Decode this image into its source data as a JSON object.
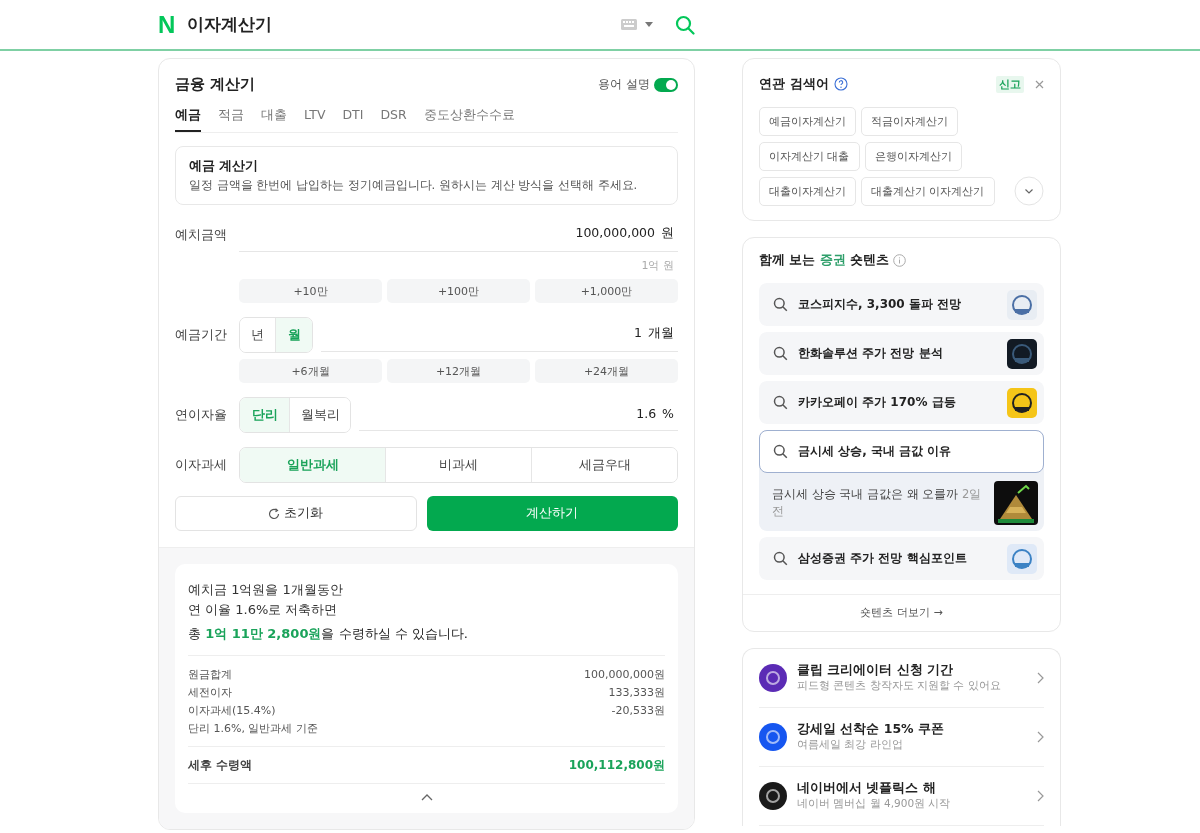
{
  "header": {
    "logo": "N",
    "title": "이자계산기"
  },
  "calculator": {
    "title": "금융 계산기",
    "term_toggle": {
      "label": "용어 설명",
      "on": true
    },
    "tabs": [
      {
        "label": "예금",
        "selected": true
      },
      {
        "label": "적금",
        "selected": false
      },
      {
        "label": "대출",
        "selected": false
      },
      {
        "label": "LTV",
        "selected": false
      },
      {
        "label": "DTI",
        "selected": false
      },
      {
        "label": "DSR",
        "selected": false
      },
      {
        "label": "중도상환수수료",
        "selected": false
      }
    ],
    "info": {
      "title": "예금 계산기",
      "description": "일정 금액을 한번에 납입하는 정기예금입니다. 원하시는 계산 방식을 선택해 주세요."
    },
    "amount": {
      "label": "예치금액",
      "value": "100,000,000",
      "unit": "원",
      "hint": "1억 원",
      "quick": [
        "+10만",
        "+100만",
        "+1,000만"
      ]
    },
    "period": {
      "label": "예금기간",
      "units": [
        {
          "label": "년",
          "selected": false
        },
        {
          "label": "월",
          "selected": true
        }
      ],
      "value": "1",
      "unit": "개월",
      "quick": [
        "+6개월",
        "+12개월",
        "+24개월"
      ]
    },
    "rate": {
      "label": "연이자율",
      "types": [
        {
          "label": "단리",
          "selected": true
        },
        {
          "label": "월복리",
          "selected": false
        }
      ],
      "value": "1.6",
      "unit": "%"
    },
    "tax": {
      "label": "이자과세",
      "options": [
        {
          "label": "일반과세",
          "selected": true
        },
        {
          "label": "비과세",
          "selected": false
        },
        {
          "label": "세금우대",
          "selected": false
        }
      ]
    },
    "reset_button": "초기화",
    "calculate_button": "계산하기"
  },
  "result": {
    "lines": [
      "예치금 1억원을 1개월동안",
      "연 이율 1.6%로 저축하면"
    ],
    "total": "총 **1억 11만 2,800원**을 수령하실 수 있습니다.",
    "rows": [
      {
        "label": "원금합계",
        "value": "100,000,000원"
      },
      {
        "label": "세전이자",
        "value": "133,333원"
      },
      {
        "label": "이자과세(15.4%)",
        "value": "-20,533원"
      }
    ],
    "note": "단리 1.6%, 일반과세 기준",
    "after_tax": {
      "label": "세후 수령액",
      "value": "100,112,800원"
    }
  },
  "related": {
    "title": "연관 검색어",
    "report": "신고",
    "tags": [
      "예금이자계산기",
      "적금이자계산기",
      "이자계산기 대출",
      "은행이자계산기",
      "대출이자계산기",
      "대출계산기 이자계산기"
    ]
  },
  "shorts": {
    "title_parts": [
      {
        "text": "함께 보는",
        "highlight": false
      },
      {
        "text": "증권",
        "highlight": true
      },
      {
        "text": "숏텐츠",
        "highlight": false
      }
    ],
    "items": [
      {
        "query": "코스피지수, 3,300 돌파 전망",
        "selected": false,
        "expanded": false
      },
      {
        "query": "한화솔루션 주가 전망 분석",
        "selected": false,
        "expanded": false
      },
      {
        "query": "카카오페이 주가 170% 급등",
        "selected": false,
        "expanded": false
      },
      {
        "query": "금시세 상승, 국내 금값 이유",
        "selected": true,
        "expanded": true,
        "preview": "금시세 상승 국내 금값은 왜 오를까",
        "date": "2일 전"
      },
      {
        "query": "삼성증권 주가 전망 핵심포인트",
        "selected": false,
        "expanded": false
      }
    ],
    "more": "숏텐츠 더보기 →"
  },
  "promos": [
    {
      "title": "클립 크리에이터 신청 기간",
      "subtitle": "피드형 콘텐츠 창작자도 지원할 수 있어요",
      "color": "#5b2bb5"
    },
    {
      "title": "강세일 선착순 15% 쿠폰",
      "subtitle": "여름세일 최강 라인업",
      "color": "#1656f0"
    },
    {
      "title": "네이버에서 넷플릭스 해",
      "subtitle": "네이버 멤버십 월 4,900원 시작",
      "color": "#1a1a1a"
    }
  ]
}
